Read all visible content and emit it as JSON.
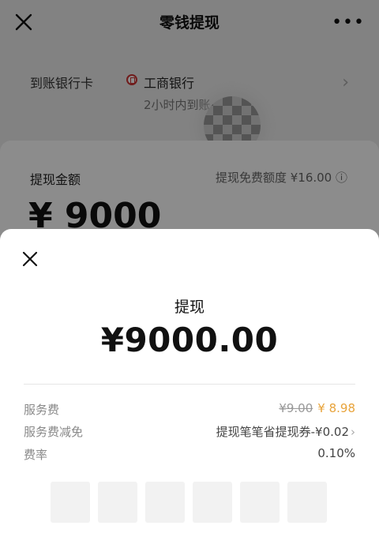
{
  "header": {
    "title": "零钱提现",
    "more": "•••"
  },
  "bank": {
    "label": "到账银行卡",
    "name": "工商银行",
    "arrival": "2小时内到账"
  },
  "card": {
    "amount_label": "提现金额",
    "free_quota": "提现免费额度 ¥16.00 ⓘ",
    "amount_preview": "¥ 9000"
  },
  "sheet": {
    "title": "提现",
    "amount": "¥9000.00",
    "rows": [
      {
        "label": "服务费",
        "original": "¥9.00",
        "fee": "¥ 8.98"
      },
      {
        "label": "服务费减免",
        "value": "提现笔笔省提现券-¥0.02"
      },
      {
        "label": "费率",
        "value": "0.10%"
      }
    ],
    "pin_length": 6
  }
}
